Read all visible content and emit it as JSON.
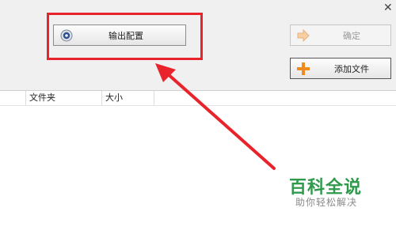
{
  "window": {
    "close_glyph": "✕"
  },
  "toolbar": {
    "output_config_label": "输出配置",
    "confirm_label": "确定",
    "add_file_label": "添加文件"
  },
  "file_list": {
    "columns": [
      "文件夹",
      "大小"
    ]
  },
  "watermark": {
    "title": "百科全说",
    "subtitle": "助你轻松解决"
  },
  "colors": {
    "highlight_red": "#e8232b",
    "watermark_green": "#2f9a4b",
    "add_icon_orange": "#f08a1c"
  },
  "icons": {
    "output_config": "gear-icon",
    "confirm": "arrow-right-icon",
    "add_file": "plus-icon"
  }
}
